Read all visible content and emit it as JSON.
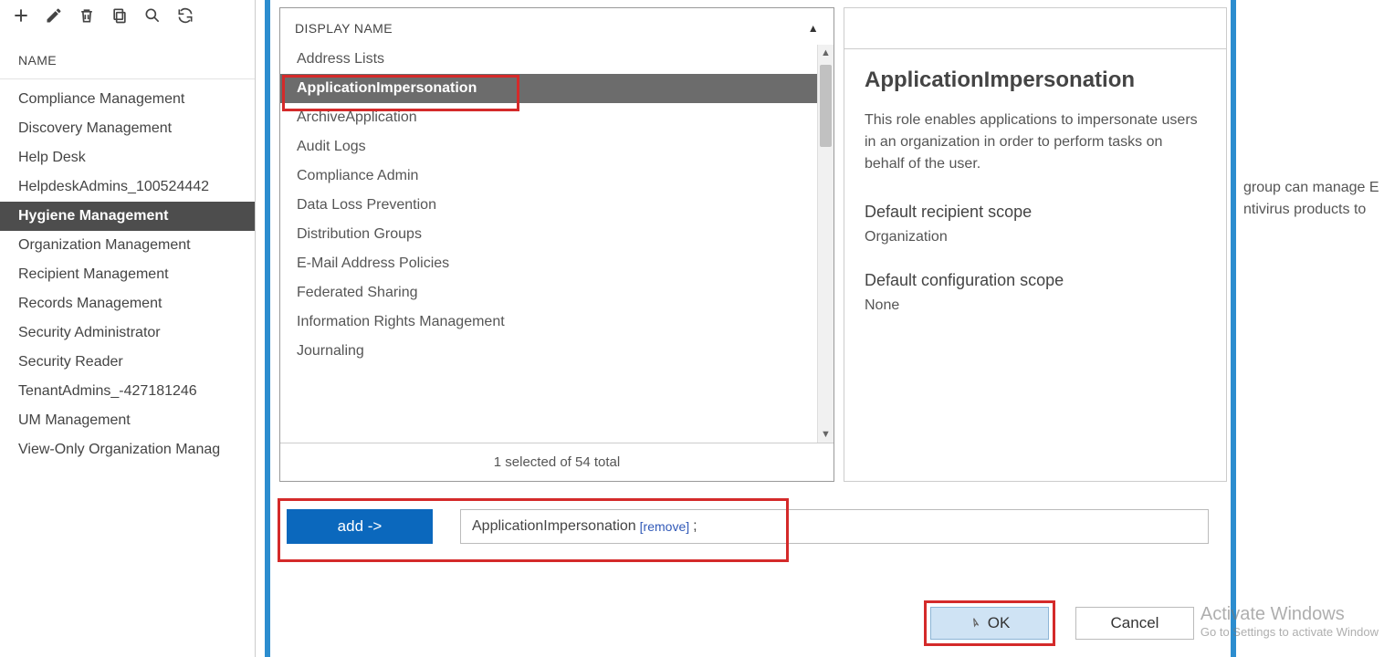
{
  "sidebar": {
    "header": "NAME",
    "items": [
      "Compliance Management",
      "Discovery Management",
      "Help Desk",
      "HelpdeskAdmins_100524442",
      "Hygiene Management",
      "Organization Management",
      "Recipient Management",
      "Records Management",
      "Security Administrator",
      "Security Reader",
      "TenantAdmins_-427181246",
      "UM Management",
      "View-Only Organization Manag"
    ],
    "selected_index": 4
  },
  "roles": {
    "header": "DISPLAY NAME",
    "items": [
      "Address Lists",
      "ApplicationImpersonation",
      "ArchiveApplication",
      "Audit Logs",
      "Compliance Admin",
      "Data Loss Prevention",
      "Distribution Groups",
      "E-Mail Address Policies",
      "Federated Sharing",
      "Information Rights Management",
      "Journaling"
    ],
    "selected_index": 1,
    "status": "1 selected of 54 total"
  },
  "detail": {
    "title": "ApplicationImpersonation",
    "desc": "This role enables applications to impersonate users in an organization in order to perform tasks on behalf of the user.",
    "scope_label": "Default recipient scope",
    "scope_value": "Organization",
    "config_label": "Default configuration scope",
    "config_value": "None"
  },
  "add": {
    "button": "add ->",
    "selected": "ApplicationImpersonation",
    "remove": "[remove]",
    "sep": ";"
  },
  "footer": {
    "ok": "OK",
    "cancel": "Cancel"
  },
  "right_crop": {
    "l1": "group can manage E",
    "l2": "ntivirus products to"
  },
  "watermark": {
    "l1": "Activate Windows",
    "l2": "Go to Settings to activate Window"
  },
  "icons": {
    "sort": "▲"
  }
}
